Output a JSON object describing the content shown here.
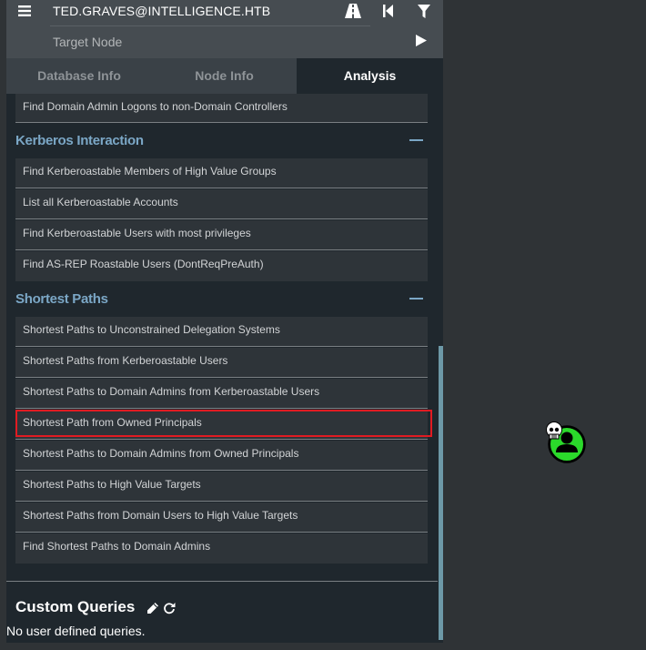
{
  "search": {
    "start_node": "TED.GRAVES@INTELLIGENCE.HTB",
    "target_placeholder": "Target Node"
  },
  "icons": {
    "menu": "menu-icon",
    "pathfinding": "road-icon",
    "back": "back-icon",
    "filter": "filter-icon",
    "play": "play-icon",
    "edit": "pencil-icon",
    "refresh": "refresh-icon",
    "node": "user-node-icon",
    "owned_marker": "skull-icon"
  },
  "tabs": [
    {
      "label": "Database Info"
    },
    {
      "label": "Node Info"
    },
    {
      "label": "Analysis"
    }
  ],
  "analysis": {
    "partial_item": "Find Domain Admin Logons to non-Domain Controllers",
    "sections": [
      {
        "title": "Kerberos Interaction",
        "items": [
          "Find Kerberoastable Members of High Value Groups",
          "List all Kerberoastable Accounts",
          "Find Kerberoastable Users with most privileges",
          "Find AS-REP Roastable Users (DontReqPreAuth)"
        ]
      },
      {
        "title": "Shortest Paths",
        "items": [
          "Shortest Paths to Unconstrained Delegation Systems",
          "Shortest Paths from Kerberoastable Users",
          "Shortest Paths to Domain Admins from Kerberoastable Users",
          "Shortest Path from Owned Principals",
          "Shortest Paths to Domain Admins from Owned Principals",
          "Shortest Paths to High Value Targets",
          "Shortest Paths from Domain Users to High Value Targets",
          "Find Shortest Paths to Domain Admins"
        ]
      }
    ]
  },
  "custom_queries": {
    "title": "Custom Queries",
    "empty_text": "No user defined queries."
  },
  "colors": {
    "accent": "#7ba7c6",
    "highlight": "#e11b22",
    "node_green": "#2bd92b"
  }
}
